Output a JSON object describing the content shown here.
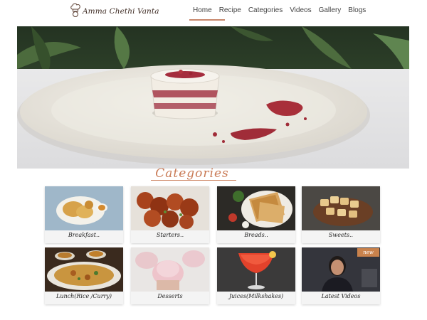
{
  "header": {
    "logo_text": "Amma Chethi Vanta",
    "nav": [
      "Home",
      "Recipe",
      "Categories",
      "Videos",
      "Gallery",
      "Blogs"
    ]
  },
  "section": {
    "title": "Categories"
  },
  "categories": [
    {
      "label": "Breakfast.."
    },
    {
      "label": "Starters.."
    },
    {
      "label": "Breads.."
    },
    {
      "label": "Sweets.."
    },
    {
      "label": "Lunch(Rice /Curry)"
    },
    {
      "label": "Desserts"
    },
    {
      "label": "Juices(Milkshakes)"
    },
    {
      "label": "Latest Videos",
      "badge": "new"
    }
  ],
  "colors": {
    "accent": "#c97a55",
    "nav_underline": "#c7866a",
    "badge": "#c9824c"
  }
}
